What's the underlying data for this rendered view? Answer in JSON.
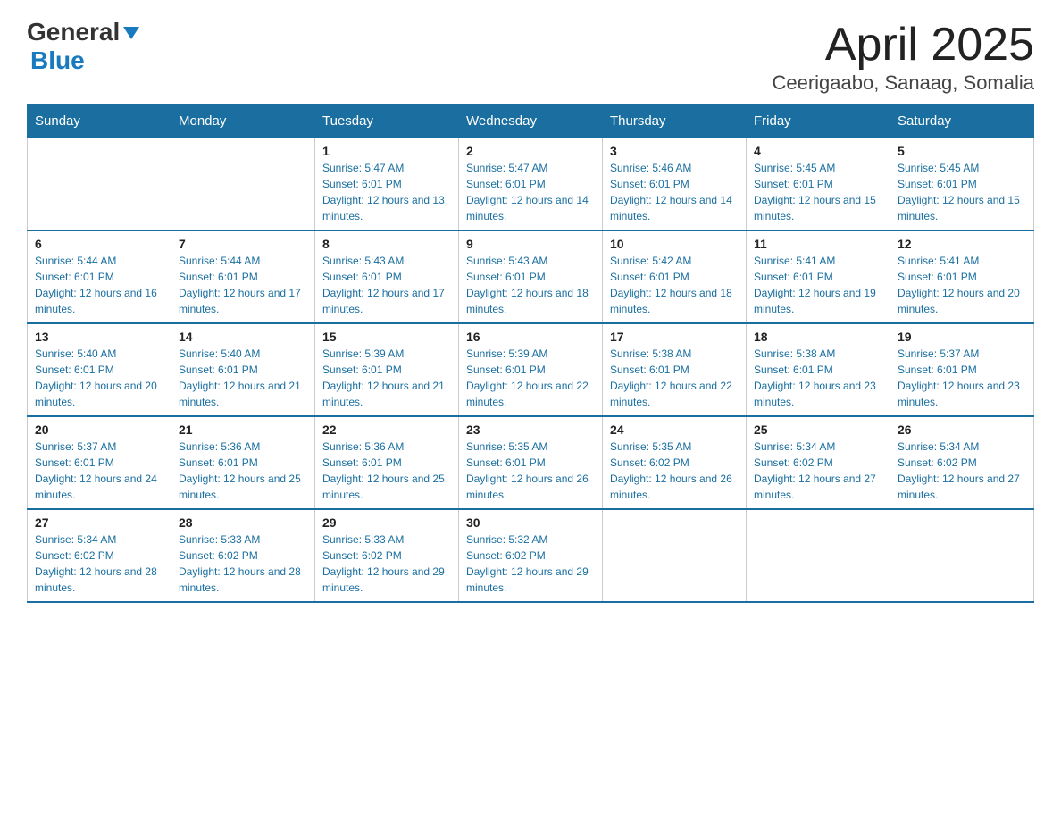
{
  "header": {
    "logo_general": "General",
    "logo_triangle": "▶",
    "logo_blue": "Blue",
    "title": "April 2025",
    "subtitle": "Ceerigaabo, Sanaag, Somalia"
  },
  "calendar": {
    "days": [
      "Sunday",
      "Monday",
      "Tuesday",
      "Wednesday",
      "Thursday",
      "Friday",
      "Saturday"
    ],
    "weeks": [
      [
        {
          "num": "",
          "sunrise": "",
          "sunset": "",
          "daylight": ""
        },
        {
          "num": "",
          "sunrise": "",
          "sunset": "",
          "daylight": ""
        },
        {
          "num": "1",
          "sunrise": "Sunrise: 5:47 AM",
          "sunset": "Sunset: 6:01 PM",
          "daylight": "Daylight: 12 hours and 13 minutes."
        },
        {
          "num": "2",
          "sunrise": "Sunrise: 5:47 AM",
          "sunset": "Sunset: 6:01 PM",
          "daylight": "Daylight: 12 hours and 14 minutes."
        },
        {
          "num": "3",
          "sunrise": "Sunrise: 5:46 AM",
          "sunset": "Sunset: 6:01 PM",
          "daylight": "Daylight: 12 hours and 14 minutes."
        },
        {
          "num": "4",
          "sunrise": "Sunrise: 5:45 AM",
          "sunset": "Sunset: 6:01 PM",
          "daylight": "Daylight: 12 hours and 15 minutes."
        },
        {
          "num": "5",
          "sunrise": "Sunrise: 5:45 AM",
          "sunset": "Sunset: 6:01 PM",
          "daylight": "Daylight: 12 hours and 15 minutes."
        }
      ],
      [
        {
          "num": "6",
          "sunrise": "Sunrise: 5:44 AM",
          "sunset": "Sunset: 6:01 PM",
          "daylight": "Daylight: 12 hours and 16 minutes."
        },
        {
          "num": "7",
          "sunrise": "Sunrise: 5:44 AM",
          "sunset": "Sunset: 6:01 PM",
          "daylight": "Daylight: 12 hours and 17 minutes."
        },
        {
          "num": "8",
          "sunrise": "Sunrise: 5:43 AM",
          "sunset": "Sunset: 6:01 PM",
          "daylight": "Daylight: 12 hours and 17 minutes."
        },
        {
          "num": "9",
          "sunrise": "Sunrise: 5:43 AM",
          "sunset": "Sunset: 6:01 PM",
          "daylight": "Daylight: 12 hours and 18 minutes."
        },
        {
          "num": "10",
          "sunrise": "Sunrise: 5:42 AM",
          "sunset": "Sunset: 6:01 PM",
          "daylight": "Daylight: 12 hours and 18 minutes."
        },
        {
          "num": "11",
          "sunrise": "Sunrise: 5:41 AM",
          "sunset": "Sunset: 6:01 PM",
          "daylight": "Daylight: 12 hours and 19 minutes."
        },
        {
          "num": "12",
          "sunrise": "Sunrise: 5:41 AM",
          "sunset": "Sunset: 6:01 PM",
          "daylight": "Daylight: 12 hours and 20 minutes."
        }
      ],
      [
        {
          "num": "13",
          "sunrise": "Sunrise: 5:40 AM",
          "sunset": "Sunset: 6:01 PM",
          "daylight": "Daylight: 12 hours and 20 minutes."
        },
        {
          "num": "14",
          "sunrise": "Sunrise: 5:40 AM",
          "sunset": "Sunset: 6:01 PM",
          "daylight": "Daylight: 12 hours and 21 minutes."
        },
        {
          "num": "15",
          "sunrise": "Sunrise: 5:39 AM",
          "sunset": "Sunset: 6:01 PM",
          "daylight": "Daylight: 12 hours and 21 minutes."
        },
        {
          "num": "16",
          "sunrise": "Sunrise: 5:39 AM",
          "sunset": "Sunset: 6:01 PM",
          "daylight": "Daylight: 12 hours and 22 minutes."
        },
        {
          "num": "17",
          "sunrise": "Sunrise: 5:38 AM",
          "sunset": "Sunset: 6:01 PM",
          "daylight": "Daylight: 12 hours and 22 minutes."
        },
        {
          "num": "18",
          "sunrise": "Sunrise: 5:38 AM",
          "sunset": "Sunset: 6:01 PM",
          "daylight": "Daylight: 12 hours and 23 minutes."
        },
        {
          "num": "19",
          "sunrise": "Sunrise: 5:37 AM",
          "sunset": "Sunset: 6:01 PM",
          "daylight": "Daylight: 12 hours and 23 minutes."
        }
      ],
      [
        {
          "num": "20",
          "sunrise": "Sunrise: 5:37 AM",
          "sunset": "Sunset: 6:01 PM",
          "daylight": "Daylight: 12 hours and 24 minutes."
        },
        {
          "num": "21",
          "sunrise": "Sunrise: 5:36 AM",
          "sunset": "Sunset: 6:01 PM",
          "daylight": "Daylight: 12 hours and 25 minutes."
        },
        {
          "num": "22",
          "sunrise": "Sunrise: 5:36 AM",
          "sunset": "Sunset: 6:01 PM",
          "daylight": "Daylight: 12 hours and 25 minutes."
        },
        {
          "num": "23",
          "sunrise": "Sunrise: 5:35 AM",
          "sunset": "Sunset: 6:01 PM",
          "daylight": "Daylight: 12 hours and 26 minutes."
        },
        {
          "num": "24",
          "sunrise": "Sunrise: 5:35 AM",
          "sunset": "Sunset: 6:02 PM",
          "daylight": "Daylight: 12 hours and 26 minutes."
        },
        {
          "num": "25",
          "sunrise": "Sunrise: 5:34 AM",
          "sunset": "Sunset: 6:02 PM",
          "daylight": "Daylight: 12 hours and 27 minutes."
        },
        {
          "num": "26",
          "sunrise": "Sunrise: 5:34 AM",
          "sunset": "Sunset: 6:02 PM",
          "daylight": "Daylight: 12 hours and 27 minutes."
        }
      ],
      [
        {
          "num": "27",
          "sunrise": "Sunrise: 5:34 AM",
          "sunset": "Sunset: 6:02 PM",
          "daylight": "Daylight: 12 hours and 28 minutes."
        },
        {
          "num": "28",
          "sunrise": "Sunrise: 5:33 AM",
          "sunset": "Sunset: 6:02 PM",
          "daylight": "Daylight: 12 hours and 28 minutes."
        },
        {
          "num": "29",
          "sunrise": "Sunrise: 5:33 AM",
          "sunset": "Sunset: 6:02 PM",
          "daylight": "Daylight: 12 hours and 29 minutes."
        },
        {
          "num": "30",
          "sunrise": "Sunrise: 5:32 AM",
          "sunset": "Sunset: 6:02 PM",
          "daylight": "Daylight: 12 hours and 29 minutes."
        },
        {
          "num": "",
          "sunrise": "",
          "sunset": "",
          "daylight": ""
        },
        {
          "num": "",
          "sunrise": "",
          "sunset": "",
          "daylight": ""
        },
        {
          "num": "",
          "sunrise": "",
          "sunset": "",
          "daylight": ""
        }
      ]
    ]
  }
}
